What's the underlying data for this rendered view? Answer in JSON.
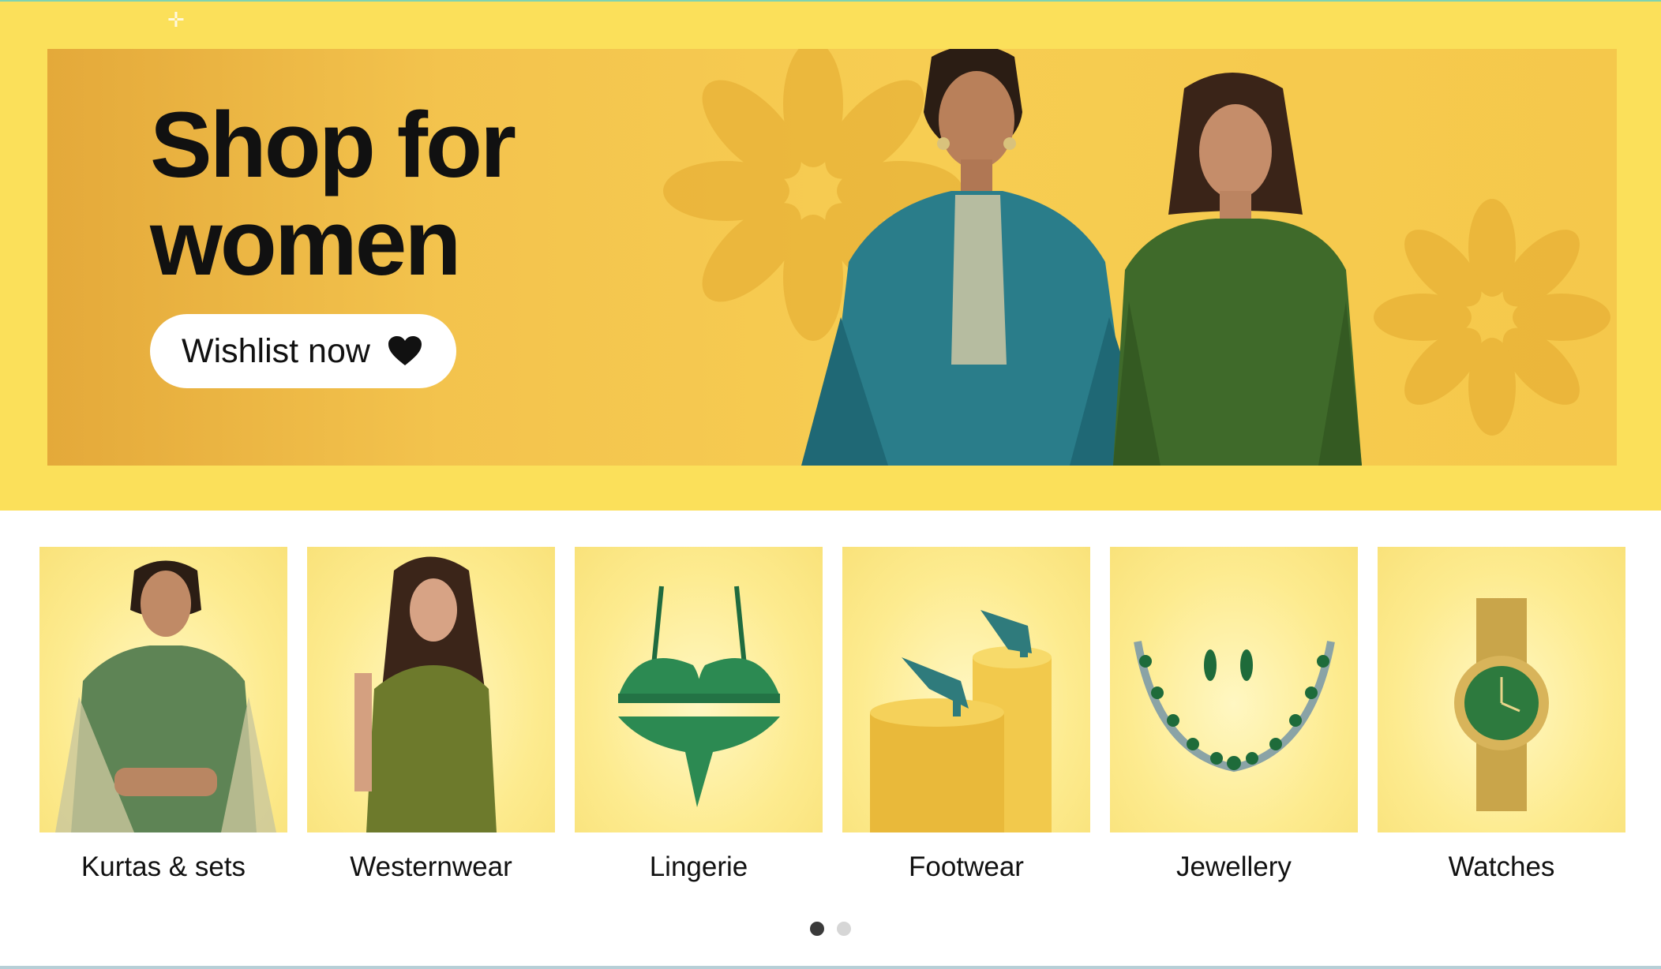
{
  "hero": {
    "title": "Shop for\nwomen",
    "cta_label": "Wishlist now",
    "cta_icon": "heart-icon",
    "background_color": "#fbe05a",
    "banner_color": "#f5c84b"
  },
  "categories": [
    {
      "label": "Kurtas & sets",
      "icon": "kurta-model-image"
    },
    {
      "label": "Westernwear",
      "icon": "westernwear-model-image"
    },
    {
      "label": "Lingerie",
      "icon": "lingerie-image"
    },
    {
      "label": "Footwear",
      "icon": "heels-image"
    },
    {
      "label": "Jewellery",
      "icon": "necklace-image"
    },
    {
      "label": "Watches",
      "icon": "watch-image"
    }
  ],
  "carousel": {
    "pages": 2,
    "active_page": 1
  }
}
